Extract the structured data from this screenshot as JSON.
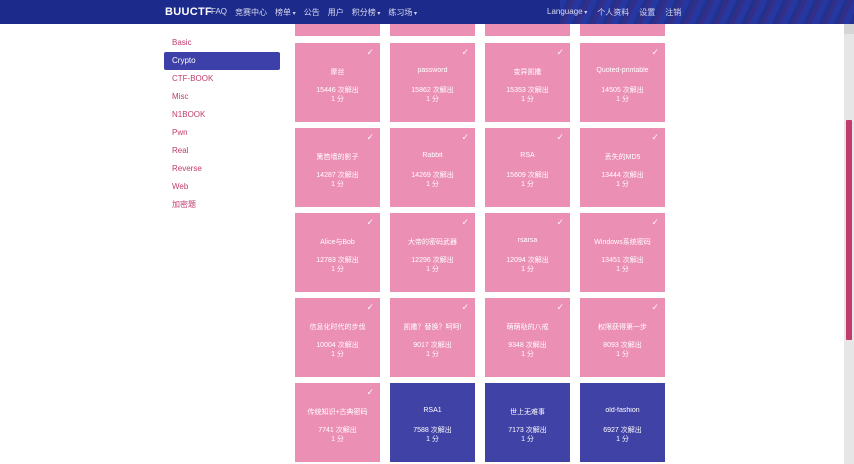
{
  "navbar": {
    "brand": "BUUCTF",
    "left_items": [
      {
        "label": "FAQ",
        "dropdown": false
      },
      {
        "label": "竞赛中心",
        "dropdown": false
      },
      {
        "label": "榜单",
        "dropdown": true
      },
      {
        "label": "公告",
        "dropdown": false
      },
      {
        "label": "用户",
        "dropdown": false
      },
      {
        "label": "积分榜",
        "dropdown": true
      },
      {
        "label": "练习场",
        "dropdown": true
      }
    ],
    "right_items": [
      {
        "label": "Language",
        "dropdown": true
      },
      {
        "label": "个人资料",
        "dropdown": false
      },
      {
        "label": "设置",
        "dropdown": false
      },
      {
        "label": "注销",
        "dropdown": false
      }
    ]
  },
  "sidebar": {
    "categories": [
      {
        "label": "Basic",
        "active": false
      },
      {
        "label": "Crypto",
        "active": true
      },
      {
        "label": "CTF-BOOK",
        "active": false
      },
      {
        "label": "Misc",
        "active": false
      },
      {
        "label": "N1BOOK",
        "active": false
      },
      {
        "label": "Pwn",
        "active": false
      },
      {
        "label": "Real",
        "active": false
      },
      {
        "label": "Reverse",
        "active": false
      },
      {
        "label": "Web",
        "active": false
      },
      {
        "label": "加密题",
        "active": false
      }
    ]
  },
  "challenges": {
    "rows": [
      [
        {
          "name": "摩丝",
          "solves": "15446 次解出",
          "points": "1 分",
          "solved": true
        },
        {
          "name": "password",
          "solves": "15862 次解出",
          "points": "1 分",
          "solved": true
        },
        {
          "name": "变异凯撒",
          "solves": "15353 次解出",
          "points": "1 分",
          "solved": true
        },
        {
          "name": "Quoted-printable",
          "solves": "14505 次解出",
          "points": "1 分",
          "solved": true
        }
      ],
      [
        {
          "name": "篱笆墙的影子",
          "solves": "14287 次解出",
          "points": "1 分",
          "solved": true
        },
        {
          "name": "Rabbit",
          "solves": "14269 次解出",
          "points": "1 分",
          "solved": true
        },
        {
          "name": "RSA",
          "solves": "15609 次解出",
          "points": "1 分",
          "solved": true
        },
        {
          "name": "丢失的MD5",
          "solves": "13444 次解出",
          "points": "1 分",
          "solved": true
        }
      ],
      [
        {
          "name": "Alice与Bob",
          "solves": "12783 次解出",
          "points": "1 分",
          "solved": true
        },
        {
          "name": "大帝的密码武器",
          "solves": "12296 次解出",
          "points": "1 分",
          "solved": true
        },
        {
          "name": "rsarsa",
          "solves": "12094 次解出",
          "points": "1 分",
          "solved": true
        },
        {
          "name": "Windows系统密码",
          "solves": "13451 次解出",
          "points": "1 分",
          "solved": true
        }
      ],
      [
        {
          "name": "信息化时代的步伐",
          "solves": "10004 次解出",
          "points": "1 分",
          "solved": true
        },
        {
          "name": "凯撒？替换？呵呵!",
          "solves": "9017 次解出",
          "points": "1 分",
          "solved": true
        },
        {
          "name": "萌萌哒的八戒",
          "solves": "9348 次解出",
          "points": "1 分",
          "solved": true
        },
        {
          "name": "权限获得第一步",
          "solves": "8093 次解出",
          "points": "1 分",
          "solved": true
        }
      ],
      [
        {
          "name": "传统知识+古典密码",
          "solves": "7741 次解出",
          "points": "1 分",
          "solved": true
        },
        {
          "name": "RSA1",
          "solves": "7588 次解出",
          "points": "1 分",
          "solved": false
        },
        {
          "name": "世上无难事",
          "solves": "7173 次解出",
          "points": "1 分",
          "solved": false
        },
        {
          "name": "old-fashion",
          "solves": "6927 次解出",
          "points": "1 分",
          "solved": false
        }
      ]
    ],
    "check_glyph": "✓"
  },
  "colors": {
    "navbar": "#1c2a8c",
    "solved_card": "#ec8fb4",
    "unsolved_card": "#4042a6",
    "active_category": "#3c40a8",
    "category_text": "#c23b6d"
  }
}
